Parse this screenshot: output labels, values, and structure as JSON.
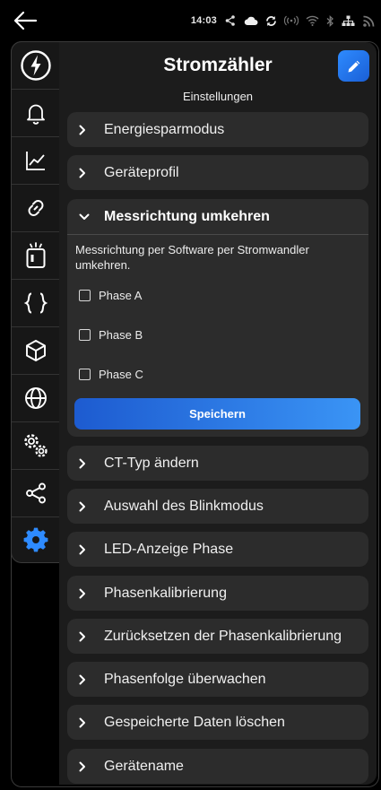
{
  "statusbar": {
    "time": "14:03"
  },
  "header": {
    "title": "Stromzähler",
    "subtitle": "Einstellungen"
  },
  "accordion": {
    "items_top": [
      {
        "label": "Energiesparmodus"
      },
      {
        "label": "Geräteprofil"
      }
    ],
    "open": {
      "label": "Messrichtung umkehren",
      "description": "Messrichtung per Software per Stromwandler umkehren.",
      "options": [
        {
          "label": "Phase A",
          "checked": false
        },
        {
          "label": "Phase B",
          "checked": false
        },
        {
          "label": "Phase C",
          "checked": false
        }
      ],
      "save_label": "Speichern"
    },
    "items_bottom": [
      {
        "label": "CT-Typ ändern"
      },
      {
        "label": "Auswahl des Blinkmodus"
      },
      {
        "label": "LED-Anzeige Phase"
      },
      {
        "label": "Phasenkalibrierung"
      },
      {
        "label": "Zurücksetzen der Phasenkalibrierung"
      },
      {
        "label": "Phasenfolge überwachen"
      },
      {
        "label": "Gespeicherte Daten löschen"
      },
      {
        "label": "Gerätename"
      }
    ]
  },
  "sidebar": {
    "items": [
      {
        "icon": "meter-logo-icon"
      },
      {
        "icon": "bell-icon"
      },
      {
        "icon": "chart-line-icon"
      },
      {
        "icon": "link-icon"
      },
      {
        "icon": "device-icon"
      },
      {
        "icon": "code-braces-icon"
      },
      {
        "icon": "cube-icon"
      },
      {
        "icon": "globe-icon"
      },
      {
        "icon": "gears-icon"
      },
      {
        "icon": "share-icon"
      },
      {
        "icon": "settings-gear-icon",
        "active": true
      }
    ]
  },
  "colors": {
    "accent": "#2e8bff",
    "panel": "#1c1c1c",
    "card": "#2c2c2c"
  }
}
